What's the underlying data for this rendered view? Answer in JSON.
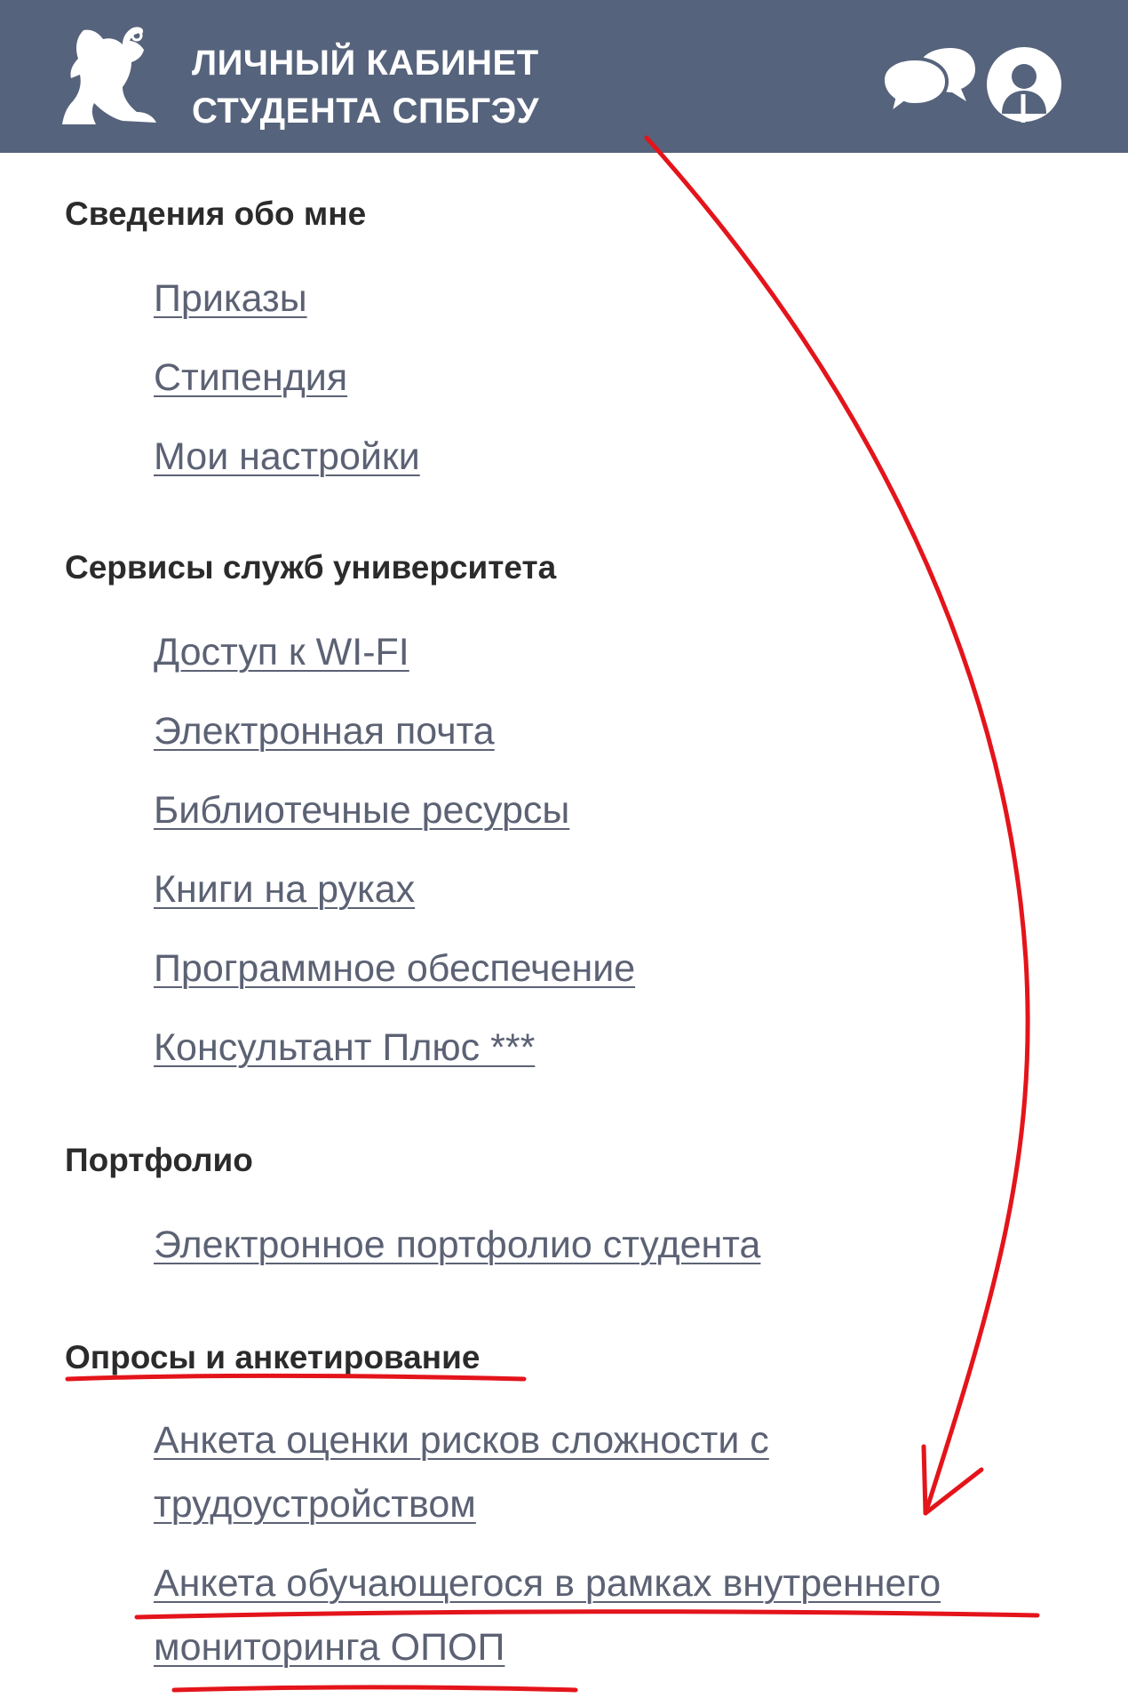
{
  "header": {
    "title_line1": "ЛИЧНЫЙ КАБИНЕТ",
    "title_line2": "СТУДЕНТА СПБГЭУ",
    "logo_icon": "griffin-logo-icon",
    "chat_icon": "chat-bubbles-icon",
    "profile_icon": "user-profile-icon"
  },
  "sections": [
    {
      "title": "Сведения обо мне",
      "links": [
        "Приказы",
        "Стипендия",
        "Мои настройки"
      ]
    },
    {
      "title": "Сервисы служб университета",
      "links": [
        "Доступ к WI-FI",
        "Электронная почта",
        "Библиотечные ресурсы",
        "Книги на руках",
        "Программное обеспечение",
        "Консультант Плюс ***"
      ]
    },
    {
      "title": "Портфолио",
      "links": [
        "Электронное портфолио студента"
      ]
    },
    {
      "title": "Опросы и анкетирование",
      "links": [
        [
          "Анкета оценки рисков сложности с",
          "трудоустройством"
        ],
        [
          "Анкета обучающегося в рамках внутреннего",
          "мониторинга ОПОП"
        ]
      ]
    }
  ],
  "colors": {
    "header_bg": "#56637c",
    "link": "#5c6274",
    "section_title": "#2b2b2b",
    "annotation_red": "#e4141b"
  }
}
